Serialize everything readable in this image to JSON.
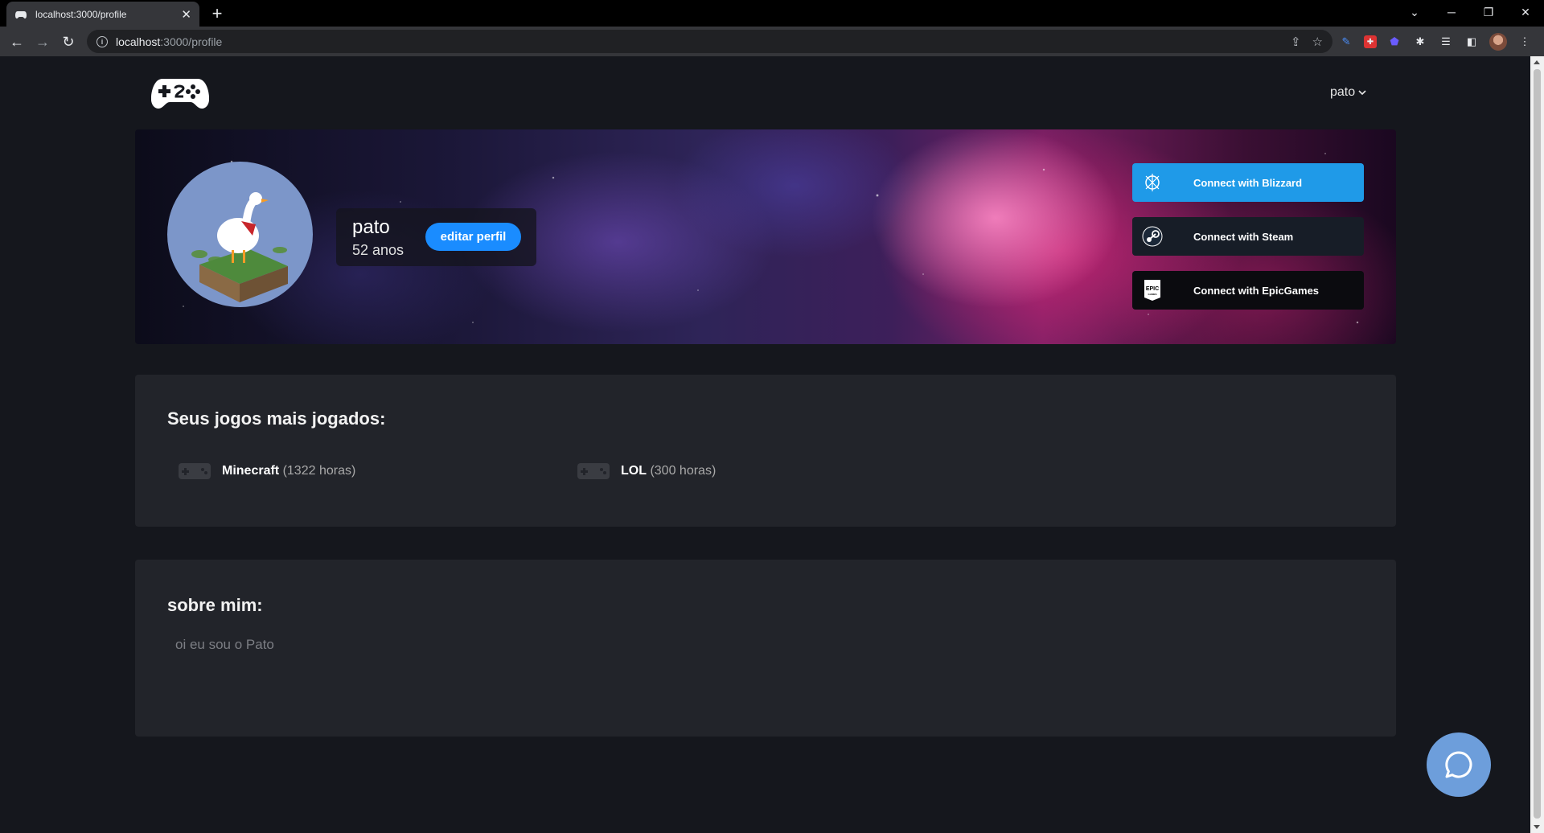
{
  "browser": {
    "tab_title": "localhost:3000/profile",
    "url_host": "localhost",
    "url_path": ":3000/profile"
  },
  "nav": {
    "username": "pato"
  },
  "profile": {
    "name": "pato",
    "age": "52 anos",
    "edit_label": "editar perfil"
  },
  "connections": [
    {
      "label": "Connect with Blizzard",
      "icon": "blizzard-icon",
      "color": "#1f9ae8"
    },
    {
      "label": "Connect with Steam",
      "icon": "steam-icon",
      "color": "#171d27"
    },
    {
      "label": "Connect with EpicGames",
      "icon": "epic-games-icon",
      "color": "#0b0b0f"
    }
  ],
  "games": {
    "title": "Seus jogos mais jogados:",
    "items": [
      {
        "name": "Minecraft",
        "hours": "(1322 horas)"
      },
      {
        "name": "LOL",
        "hours": "(300 horas)"
      }
    ]
  },
  "about": {
    "title": "sobre mim:",
    "text": "oi eu sou o Pato"
  },
  "colors": {
    "accent": "#1a8cff",
    "background": "#15171d",
    "card": "#22242a",
    "chat": "#6d9edb"
  }
}
